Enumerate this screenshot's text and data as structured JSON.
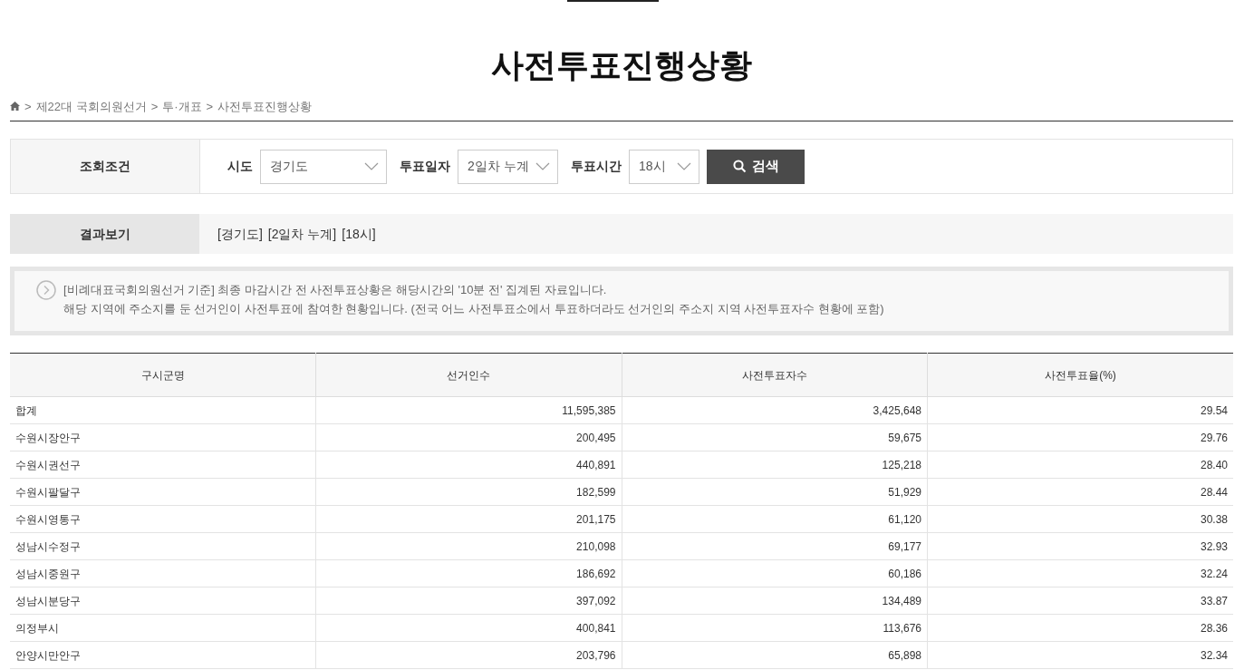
{
  "title": "사전투표진행상황",
  "breadcrumb": [
    {
      "separator": ">",
      "label": "제22대 국회의원선거"
    },
    {
      "separator": ">",
      "label": "투·개표"
    },
    {
      "separator": ">",
      "label": "사전투표진행상황"
    }
  ],
  "search": {
    "label": "조회조건",
    "filters": [
      {
        "label": "시도",
        "value": "경기도"
      },
      {
        "label": "투표일자",
        "value": "2일차 누계"
      },
      {
        "label": "투표시간",
        "value": "18시"
      }
    ],
    "button": "검색"
  },
  "result": {
    "label": "결과보기",
    "tags": [
      "[경기도]",
      "[2일차 누계]",
      "[18시]"
    ]
  },
  "notice": [
    "[비례대표국회의원선거 기준] 최종 마감시간 전 사전투표상황은 해당시간의 '10분 전' 집계된 자료입니다.",
    "해당 지역에 주소지를 둔 선거인이 사전투표에 참여한 현황입니다. (전국 어느 사전투표소에서 투표하더라도 선거인의 주소지 지역 사전투표자수 현황에 포함)"
  ],
  "table": {
    "columns": [
      "구시군명",
      "선거인수",
      "사전투표자수",
      "사전투표율(%)"
    ],
    "rows": [
      [
        "합계",
        "11,595,385",
        "3,425,648",
        "29.54"
      ],
      [
        "수원시장안구",
        "200,495",
        "59,675",
        "29.76"
      ],
      [
        "수원시권선구",
        "440,891",
        "125,218",
        "28.40"
      ],
      [
        "수원시팔달구",
        "182,599",
        "51,929",
        "28.44"
      ],
      [
        "수원시영통구",
        "201,175",
        "61,120",
        "30.38"
      ],
      [
        "성남시수정구",
        "210,098",
        "69,177",
        "32.93"
      ],
      [
        "성남시중원구",
        "186,692",
        "60,186",
        "32.24"
      ],
      [
        "성남시분당구",
        "397,092",
        "134,489",
        "33.87"
      ],
      [
        "의정부시",
        "400,841",
        "113,676",
        "28.36"
      ],
      [
        "안양시만안구",
        "203,796",
        "65,898",
        "32.34"
      ]
    ]
  }
}
